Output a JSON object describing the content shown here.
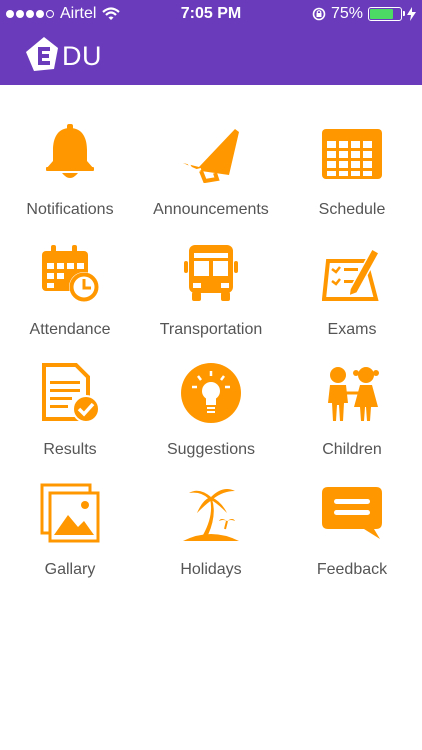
{
  "status_bar": {
    "carrier": "Airtel",
    "time": "7:05 PM",
    "battery_percent": "75%",
    "battery_level": 0.75,
    "signal_bars_filled": 4,
    "signal_bars_total": 5
  },
  "header": {
    "logo_text": "DU",
    "logo_icon": "edu-logo-icon",
    "background_color": "#6a3cbc"
  },
  "accent_color": "#ff9800",
  "menu": {
    "items": [
      {
        "label": "Notifications",
        "icon": "bell-icon"
      },
      {
        "label": "Announcements",
        "icon": "megaphone-icon"
      },
      {
        "label": "Schedule",
        "icon": "calendar-grid-icon"
      },
      {
        "label": "Attendance",
        "icon": "calendar-clock-icon"
      },
      {
        "label": "Transportation",
        "icon": "bus-icon"
      },
      {
        "label": "Exams",
        "icon": "exam-checklist-icon"
      },
      {
        "label": "Results",
        "icon": "document-check-icon"
      },
      {
        "label": "Suggestions",
        "icon": "lightbulb-icon"
      },
      {
        "label": "Children",
        "icon": "children-icon"
      },
      {
        "label": "Gallary",
        "icon": "gallery-icon"
      },
      {
        "label": "Holidays",
        "icon": "palm-tree-icon"
      },
      {
        "label": "Feedback",
        "icon": "feedback-icon"
      }
    ]
  }
}
